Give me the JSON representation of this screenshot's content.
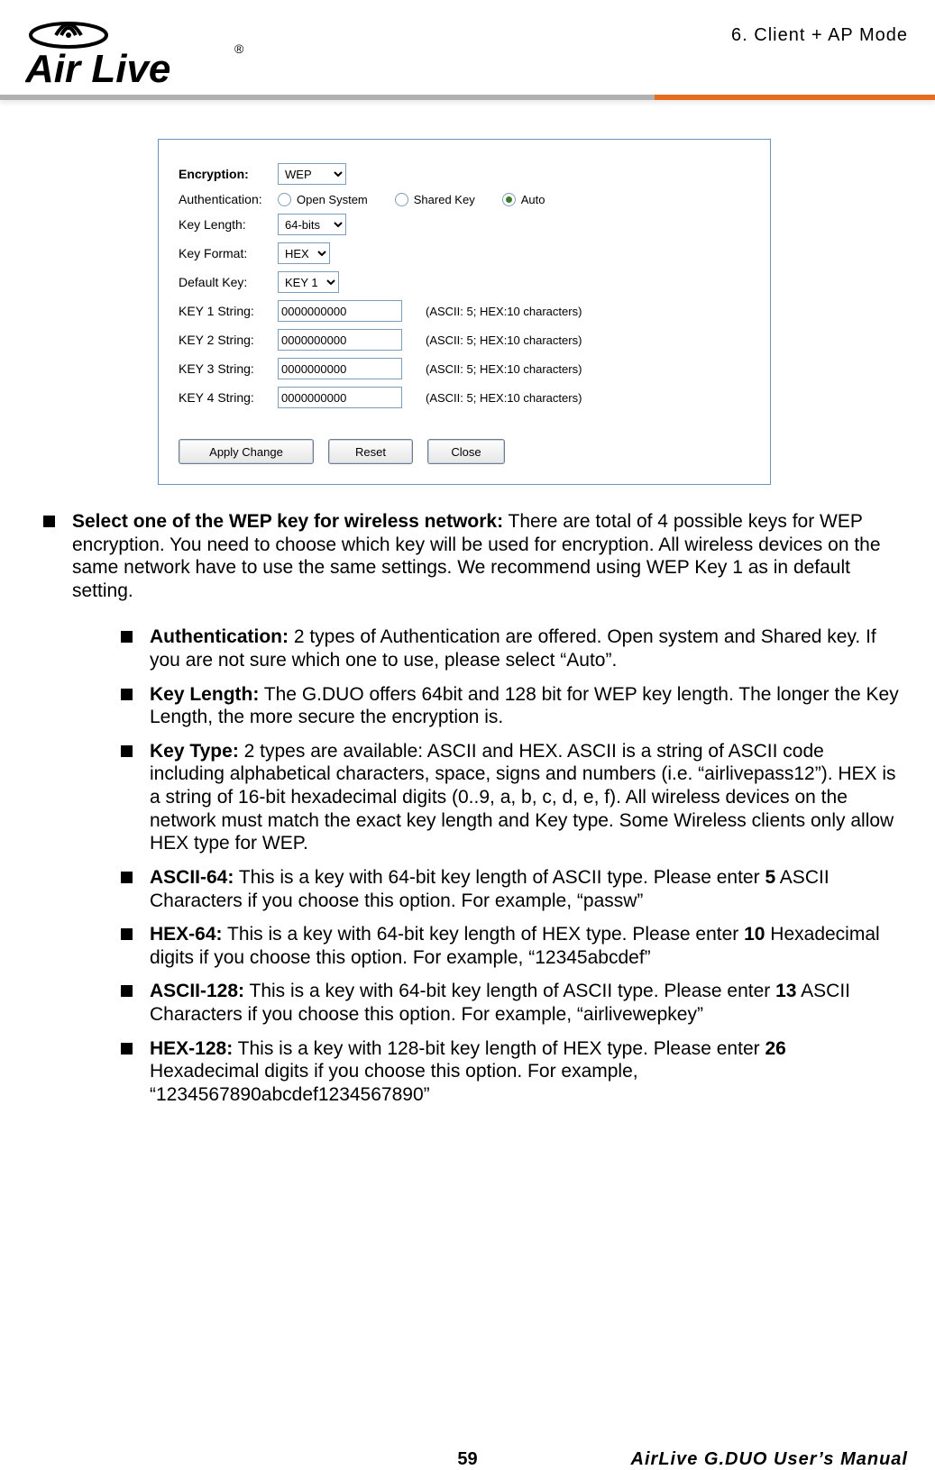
{
  "header": {
    "chapter": "6.   Client + AP Mode",
    "logo_text_main": "Air Live",
    "logo_text_r": "®"
  },
  "panel": {
    "encryption": {
      "label": "Encryption:",
      "value": "WEP"
    },
    "authentication": {
      "label": "Authentication:",
      "options": {
        "open": "Open System",
        "shared": "Shared Key",
        "auto": "Auto"
      },
      "selected": "auto"
    },
    "key_length": {
      "label": "Key Length:",
      "value": "64-bits"
    },
    "key_format": {
      "label": "Key Format:",
      "value": "HEX"
    },
    "default_key": {
      "label": "Default Key:",
      "value": "KEY 1"
    },
    "keys": [
      {
        "label": "KEY 1 String:",
        "value": "0000000000",
        "hint": "(ASCII: 5; HEX:10 characters)"
      },
      {
        "label": "KEY 2 String:",
        "value": "0000000000",
        "hint": "(ASCII: 5; HEX:10 characters)"
      },
      {
        "label": "KEY 3 String:",
        "value": "0000000000",
        "hint": "(ASCII: 5; HEX:10 characters)"
      },
      {
        "label": "KEY 4 String:",
        "value": "0000000000",
        "hint": "(ASCII: 5; HEX:10 characters)"
      }
    ],
    "buttons": {
      "apply": "Apply Change",
      "reset": "Reset",
      "close": "Close"
    }
  },
  "bullets": {
    "main": {
      "title": "Select one of the WEP key for wireless network:",
      "text": "   There are total of 4 possible keys for WEP encryption.    You need to choose which key will be used for encryption.    All wireless devices on the same network have to use the same settings.    We recommend using WEP Key 1 as in default setting."
    },
    "sub": [
      {
        "title": "Authentication:",
        "text": "   2 types of Authentication are offered.    Open system and Shared key.    If you are not sure which one to use, please select “Auto”."
      },
      {
        "title": "Key Length:",
        "text": "   The G.DUO offers 64bit and 128 bit for WEP key length.    The longer the Key Length, the more secure the encryption is."
      },
      {
        "title": "Key Type:",
        "text": "   2 types are available: ASCII and HEX.    ASCII is a string of ASCII code including alphabetical characters, space, signs and numbers (i.e. “airlivepass12”).    HEX is a string of 16-bit hexadecimal digits (0..9, a, b, c, d, e, f). All wireless devices on the network must match the exact key length and Key type. Some Wireless clients only allow HEX type for WEP."
      },
      {
        "title": "ASCII-64:",
        "text_pre": " This is a key with 64-bit key length of ASCII type.    Please enter ",
        "bold_num": "5",
        "text_post": " ASCII Characters if you choose this option. For example, “passw”"
      },
      {
        "title": "HEX-64:",
        "text_pre": " This is a key with 64-bit key length of HEX type.    Please enter ",
        "bold_num": "10",
        "text_post": " Hexadecimal digits if you choose this option. For example, “12345abcdef”"
      },
      {
        "title": "ASCII-128:",
        "text_pre": " This is a key with 64-bit key length of ASCII type.    Please enter ",
        "bold_num": "13",
        "text_post": " ASCII Characters if you choose this option. For example, “airlivewepkey”"
      },
      {
        "title": "HEX-128:",
        "text_pre": " This is a key with 128-bit key length of HEX type.    Please enter ",
        "bold_num": "26",
        "text_post": " Hexadecimal digits if you choose this option. For example, “1234567890abcdef1234567890”"
      }
    ]
  },
  "footer": {
    "page": "59",
    "manual": "AirLive G.DUO User’s Manual"
  }
}
